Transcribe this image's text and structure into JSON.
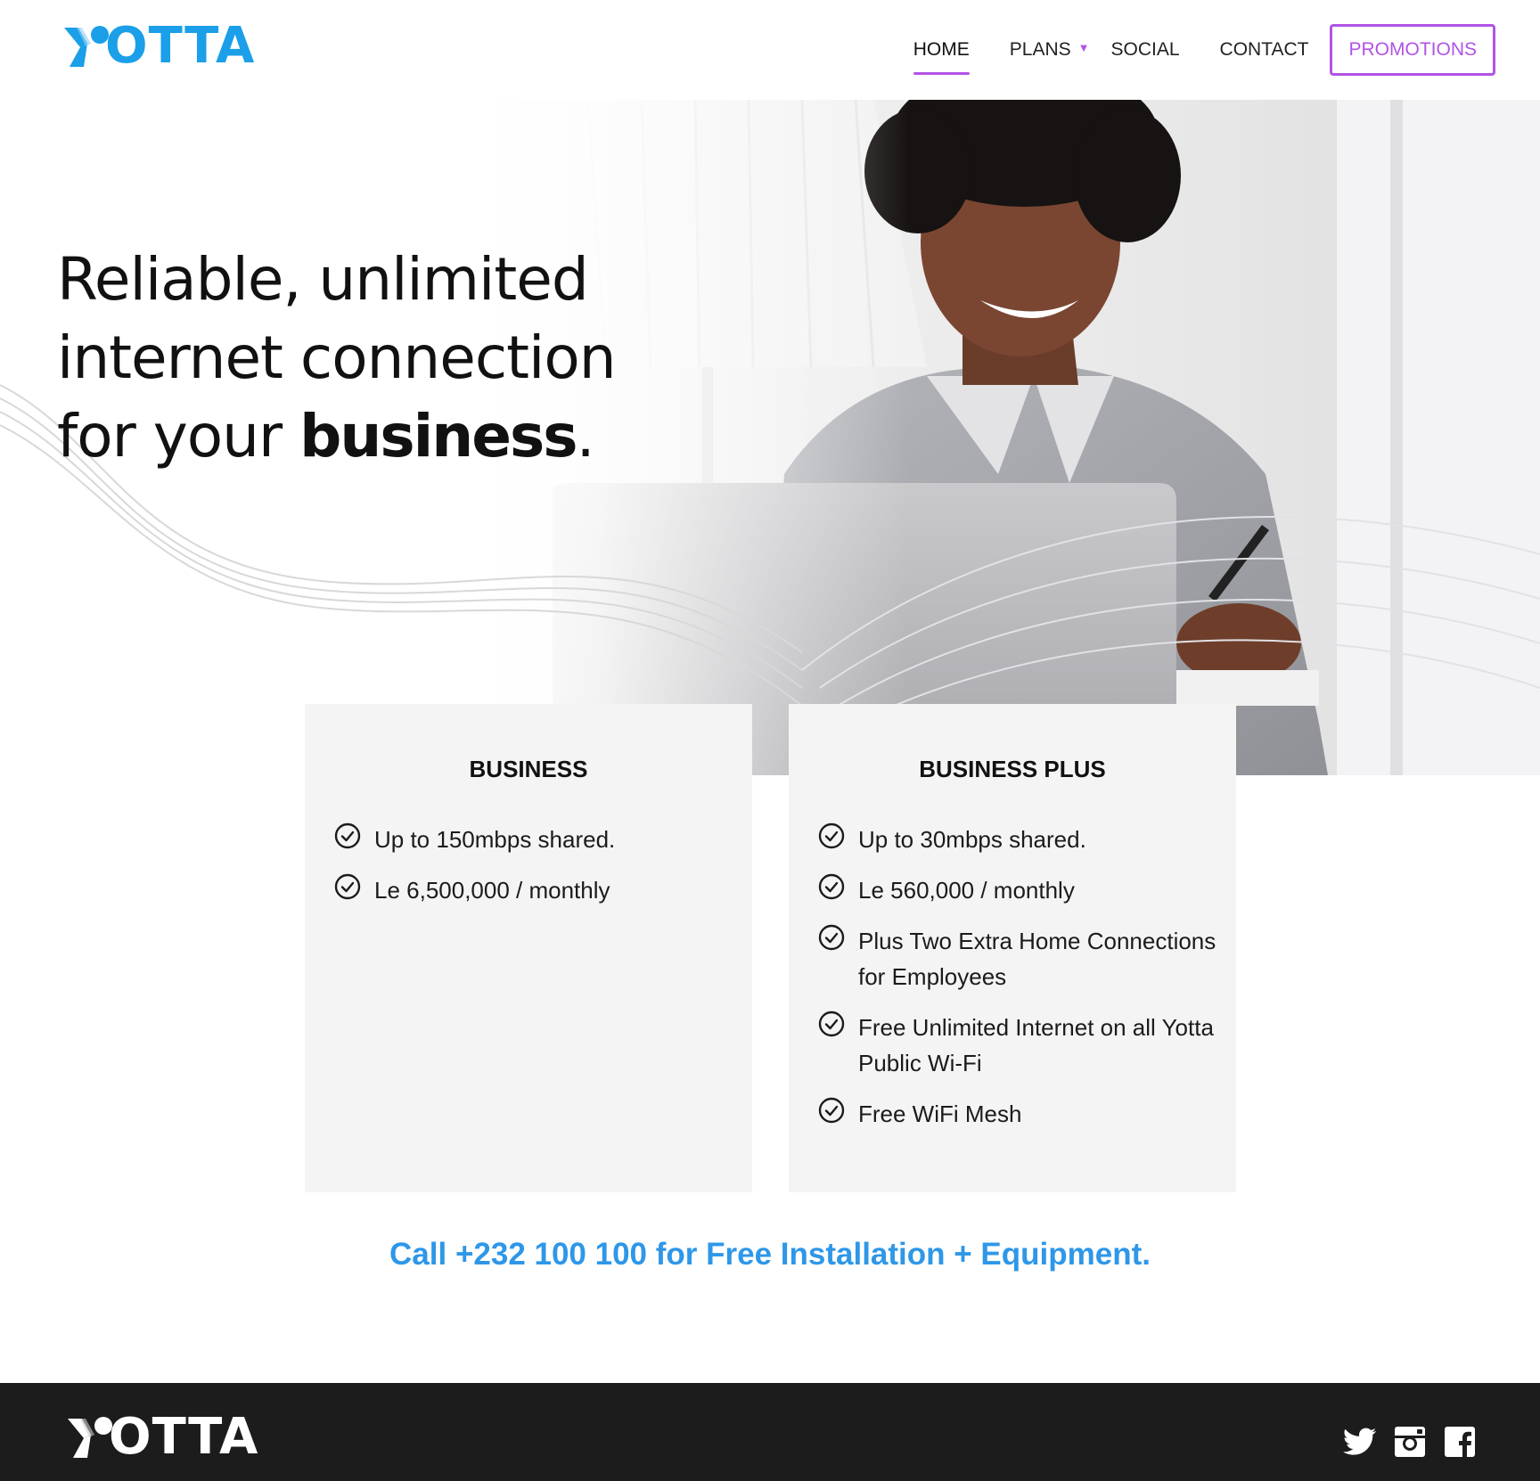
{
  "brand": {
    "name": "OTTA",
    "color": "#1a9fe8",
    "accent": "#b153e6",
    "link_color": "#2e97e8"
  },
  "nav": {
    "items": [
      {
        "label": "HOME",
        "active": true
      },
      {
        "label": "PLANS",
        "has_dropdown": true
      },
      {
        "label": "SOCIAL"
      },
      {
        "label": "CONTACT"
      }
    ],
    "promo_label": "PROMOTIONS"
  },
  "hero": {
    "line1": "Reliable, unlimited",
    "line2": "internet connection",
    "line3_prefix": "for your ",
    "line3_bold": "business",
    "line3_suffix": "."
  },
  "plans": [
    {
      "title": "BUSINESS",
      "features": [
        "Up to 150mbps shared.",
        "Le 6,500,000 / monthly"
      ]
    },
    {
      "title": "BUSINESS PLUS",
      "features": [
        "Up to 30mbps shared.",
        "Le 560,000 / monthly",
        "Plus Two Extra Home Connections for Employees",
        "Free Unlimited Internet on all Yotta Public Wi-Fi",
        "Free WiFi Mesh"
      ]
    }
  ],
  "cta": "Call +232 100 100 for Free Installation + Equipment.",
  "footer": {
    "social": [
      "twitter-icon",
      "instagram-icon",
      "facebook-icon"
    ]
  }
}
